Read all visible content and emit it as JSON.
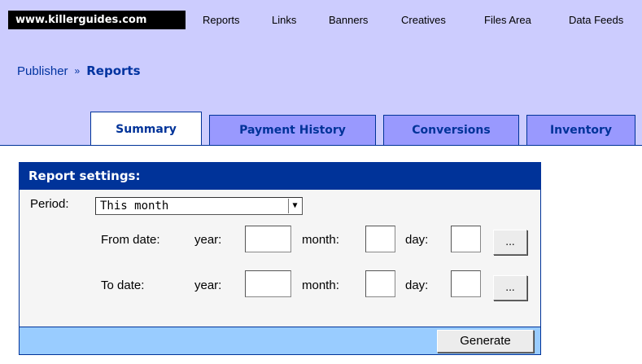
{
  "topnav": {
    "brand": "www.killerguides.com",
    "links": [
      "Reports",
      "Links",
      "Banners",
      "Creatives",
      "Files Area",
      "Data Feeds"
    ]
  },
  "breadcrumb": {
    "parent": "Publisher",
    "separator": "»",
    "current": "Reports"
  },
  "tabs": [
    "Summary",
    "Payment History",
    "Conversions",
    "Inventory"
  ],
  "active_tab": "Summary",
  "report": {
    "title": "Report settings:",
    "period_label": "Period:",
    "period_value": "This month",
    "from_label": "From date:",
    "to_label": "To date:",
    "year_label": "year:",
    "month_label": "month:",
    "day_label": "day:",
    "picker_label": "...",
    "from": {
      "year": "",
      "month": "",
      "day": ""
    },
    "to": {
      "year": "",
      "month": "",
      "day": ""
    },
    "generate_label": "Generate"
  },
  "colors": {
    "header_bg": "#ccccfe",
    "tab_bg": "#9999fe",
    "accent": "#003399",
    "footer_bg": "#99ccff"
  }
}
